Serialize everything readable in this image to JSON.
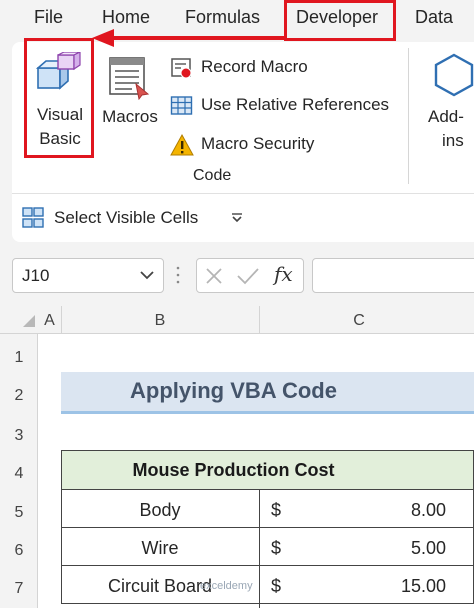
{
  "menu": {
    "tabs": [
      "File",
      "Home",
      "Formulas",
      "Developer",
      "Data"
    ]
  },
  "ribbon": {
    "visual_basic_line1": "Visual",
    "visual_basic_line2": "Basic",
    "macros_label": "Macros",
    "record_macro_label": "Record Macro",
    "use_relative_label": "Use Relative References",
    "macro_security_label": "Macro Security",
    "group_label": "Code",
    "addins_line1": "Add-",
    "addins_line2": "ins",
    "select_visible_label": "Select Visible Cells"
  },
  "formula_bar": {
    "name_box_value": "J10",
    "fx_label": "fx",
    "formula_value": ""
  },
  "sheet": {
    "columns": [
      "A",
      "B",
      "C"
    ],
    "rows": [
      "1",
      "2",
      "3",
      "4",
      "5",
      "6",
      "7"
    ],
    "title": "Applying VBA Code",
    "table_header": "Mouse Production Cost",
    "table_rows": [
      {
        "item": "Body",
        "currency": "$",
        "value": "8.00"
      },
      {
        "item": "Wire",
        "currency": "$",
        "value": "5.00"
      },
      {
        "item": "Circuit Board",
        "currency": "$",
        "value": "15.00"
      }
    ],
    "watermark": "exceldemy"
  },
  "colors": {
    "highlight": "#e0161f",
    "title_fill": "#dbe5f1",
    "header_fill": "#e2efda",
    "title_text": "#44546a"
  }
}
